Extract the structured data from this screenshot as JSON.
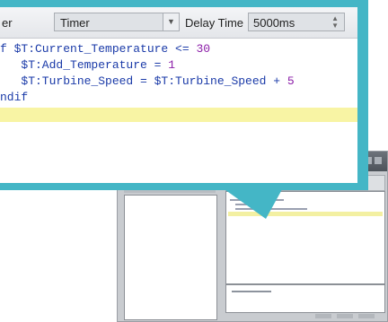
{
  "toolbar": {
    "left_fragment": "er",
    "mode_select_value": "Timer",
    "delay_label": "Delay Time",
    "delay_value": "5000ms"
  },
  "code": {
    "line1_prefix": "f $T:Current_Temperature <= ",
    "line1_num": "30",
    "line2_prefix": "   $T:Add_Temperature = ",
    "line2_num": "1",
    "line3_prefix": "   $T:Turbine_Speed = $T:Turbine_Speed + ",
    "line3_num": "5",
    "line4": "ndif"
  },
  "colors": {
    "callout": "#44b6c6",
    "keyword_text": "#1a3aa8",
    "number_text": "#8b1da8",
    "current_line": "#f8f4a4"
  },
  "icons": {
    "dropdown": "chevron-down-icon",
    "spinner": "spin-updown-icon"
  }
}
